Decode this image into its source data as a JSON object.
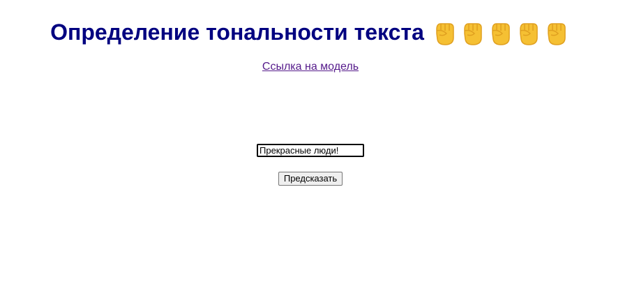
{
  "header": {
    "title": "Определение тональности текста",
    "emoji_icons": [
      "raised-fist-icon",
      "raised-fist-icon",
      "raised-fist-icon",
      "raised-fist-icon",
      "raised-fist-icon"
    ]
  },
  "model_link": {
    "label": "Ссылка на модель"
  },
  "form": {
    "input_value": "Прекрасные люди!",
    "submit_label": "Предсказать"
  },
  "colors": {
    "title": "#000080",
    "link_visited": "#551a8b",
    "fist_fill": "#f5c033",
    "fist_shade": "#e0a020"
  }
}
